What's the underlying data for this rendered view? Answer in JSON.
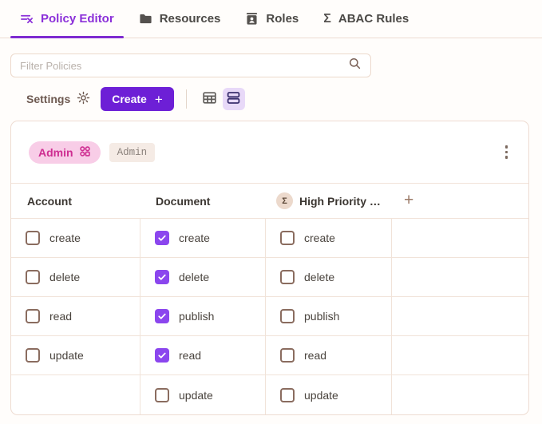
{
  "header": {
    "tabs": [
      {
        "label": "Policy Editor",
        "icon": "policy-editor-icon",
        "active": true
      },
      {
        "label": "Resources",
        "icon": "folder-icon",
        "active": false
      },
      {
        "label": "Roles",
        "icon": "id-badge-icon",
        "active": false
      },
      {
        "label": "ABAC Rules",
        "icon": "sigma-icon",
        "active": false
      }
    ]
  },
  "filter": {
    "placeholder": "Filter Policies"
  },
  "toolbar": {
    "settings_label": "Settings",
    "create_label": "Create",
    "plus_glyph": "+"
  },
  "icons": {
    "sigma_glyph": "Σ"
  },
  "policy_card": {
    "role_badge_label": "Admin",
    "role_tag_label": "Admin",
    "columns": [
      {
        "label": "Account",
        "sigma": false
      },
      {
        "label": "Document",
        "sigma": false
      },
      {
        "label": "High Priority …",
        "sigma": true
      }
    ],
    "add_column_glyph": "+",
    "rows": [
      {
        "cells": [
          {
            "label": "create",
            "checked": false
          },
          {
            "label": "create",
            "checked": true
          },
          {
            "label": "create",
            "checked": false
          },
          null
        ]
      },
      {
        "cells": [
          {
            "label": "delete",
            "checked": false
          },
          {
            "label": "delete",
            "checked": true
          },
          {
            "label": "delete",
            "checked": false
          },
          null
        ]
      },
      {
        "cells": [
          {
            "label": "read",
            "checked": false
          },
          {
            "label": "publish",
            "checked": true
          },
          {
            "label": "publish",
            "checked": false
          },
          null
        ]
      },
      {
        "cells": [
          {
            "label": "update",
            "checked": false
          },
          {
            "label": "read",
            "checked": true
          },
          {
            "label": "read",
            "checked": false
          },
          null
        ]
      },
      {
        "cells": [
          null,
          {
            "label": "update",
            "checked": false
          },
          {
            "label": "update",
            "checked": false
          },
          null
        ]
      }
    ]
  },
  "colors": {
    "accent_purple": "#6d1fd6",
    "tab_active_purple": "#8b30d9",
    "checkbox_checked_purple": "#8b46ee",
    "badge_pink_bg": "#f8cde7",
    "badge_pink_text": "#ce2d91",
    "tag_bg": "#f5ebe5",
    "warm_border": "#eedcd2",
    "view_toggle_selected_bg": "#e8d9f8"
  }
}
